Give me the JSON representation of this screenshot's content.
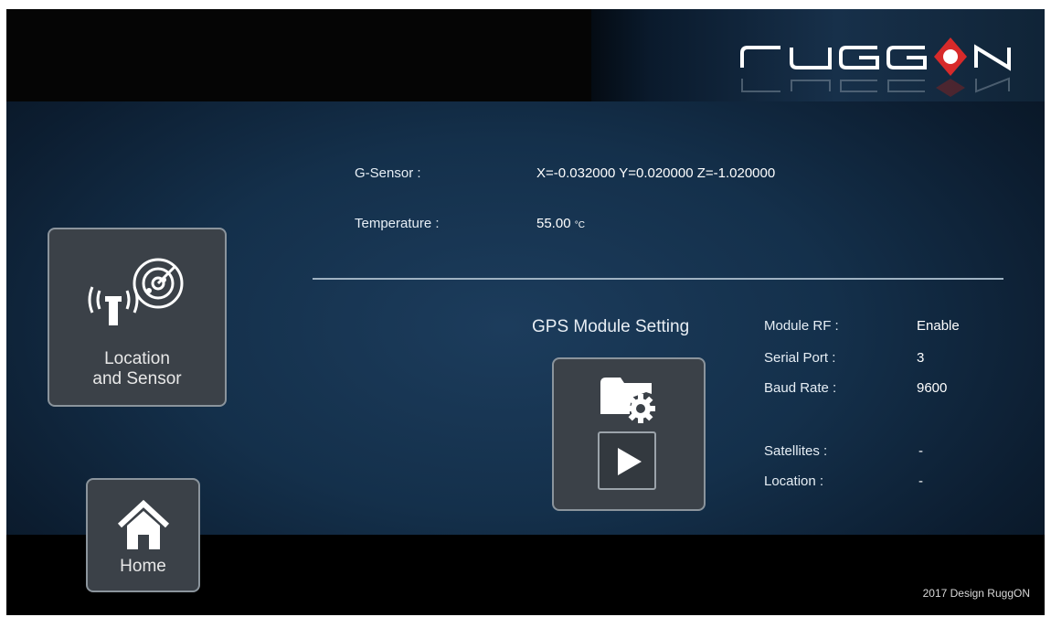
{
  "brand": {
    "logo_text": "RUGGON"
  },
  "sensors": {
    "gsensor_label": "G-Sensor :",
    "gsensor_value": "X=-0.032000 Y=0.020000 Z=-1.020000",
    "temperature_label": "Temperature :",
    "temperature_value": "55.00",
    "temperature_unit": "°C"
  },
  "nav": {
    "location_line1": "Location",
    "location_line2": "and Sensor",
    "home_label": "Home"
  },
  "gps": {
    "title": "GPS Module Setting",
    "module_rf_label": "Module RF :",
    "module_rf_value": "Enable",
    "serial_port_label": "Serial Port :",
    "serial_port_value": "3",
    "baud_rate_label": "Baud Rate :",
    "baud_rate_value": "9600",
    "satellites_label": "Satellites :",
    "satellites_value": "-",
    "location_label": "Location :",
    "location_value": "-"
  },
  "footer": {
    "text": "2017 Design RuggON"
  },
  "colors": {
    "accent_red": "#e02a2a",
    "panel_blue": "#1c3c5c",
    "tile_bg": "#3b4148"
  }
}
